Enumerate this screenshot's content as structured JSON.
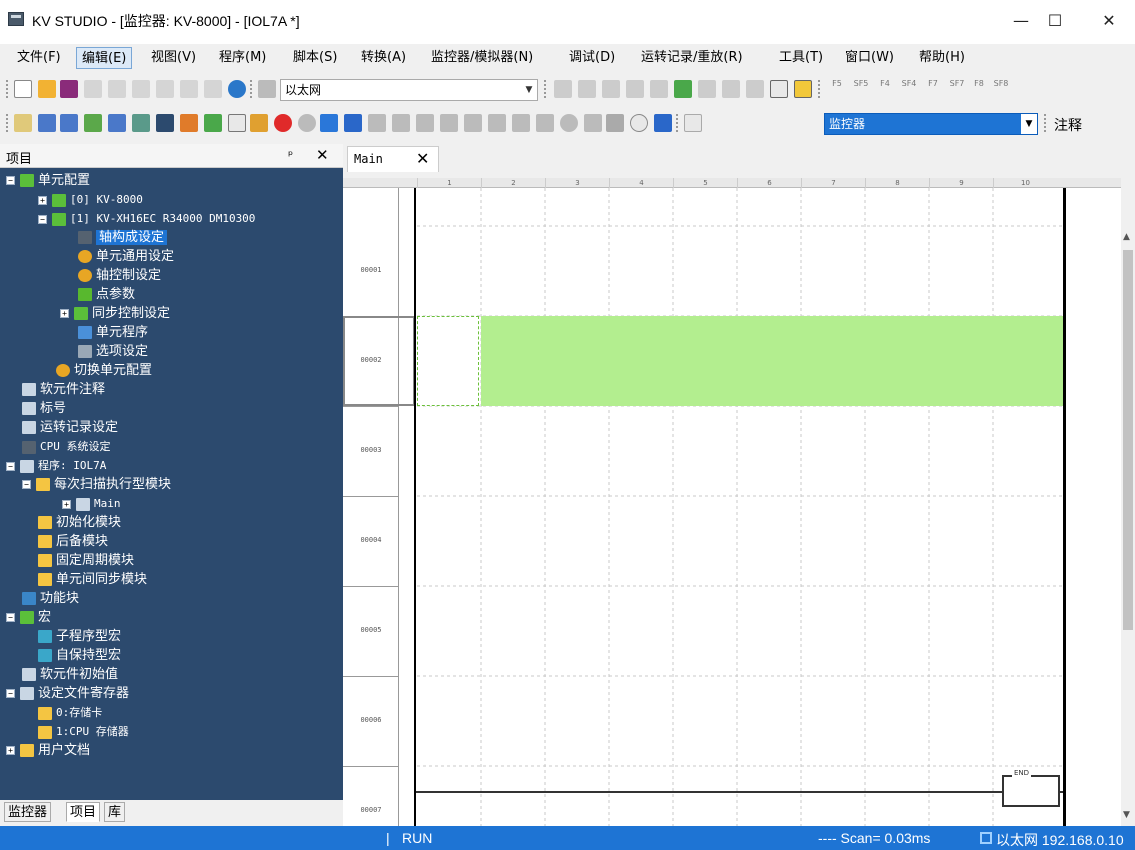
{
  "window": {
    "title": "KV STUDIO - [监控器: KV-8000] - [IOL7A *]",
    "minimize": "—",
    "maximize": "☐",
    "close": "✕"
  },
  "menubar": {
    "items": [
      {
        "label": "文件(F)"
      },
      {
        "label": "编辑(E)"
      },
      {
        "label": "视图(V)"
      },
      {
        "label": "程序(M)"
      },
      {
        "label": "脚本(S)"
      },
      {
        "label": "转换(A)"
      },
      {
        "label": "监控器/模拟器(N)"
      },
      {
        "label": "调试(D)"
      },
      {
        "label": "运转记录/重放(R)"
      },
      {
        "label": "工具(T)"
      },
      {
        "label": "窗口(W)"
      },
      {
        "label": "帮助(H)"
      }
    ]
  },
  "toolbar1": {
    "connection": "以太网",
    "fkeys": [
      "F5",
      "SF5",
      "F4",
      "SF4",
      "F7",
      "SF7",
      "F8",
      "SF8"
    ]
  },
  "toolbar2": {
    "mode": "监控器",
    "comment_label": "注释"
  },
  "left_panel": {
    "title": "项目",
    "pin": "📌",
    "close": "✕",
    "tree": [
      {
        "label": "单元配置"
      },
      {
        "label": "[0]  KV-8000"
      },
      {
        "label": "[1]  KV-XH16EC    R34000  DM10300"
      },
      {
        "label": "轴构成设定"
      },
      {
        "label": "单元通用设定"
      },
      {
        "label": "轴控制设定"
      },
      {
        "label": "点参数"
      },
      {
        "label": "同步控制设定"
      },
      {
        "label": "单元程序"
      },
      {
        "label": "选项设定"
      },
      {
        "label": "切换单元配置"
      },
      {
        "label": "软元件注释"
      },
      {
        "label": "标号"
      },
      {
        "label": "运转记录设定"
      },
      {
        "label": "CPU 系统设定"
      },
      {
        "label": "程序: IOL7A"
      },
      {
        "label": "每次扫描执行型模块"
      },
      {
        "label": "Main"
      },
      {
        "label": "初始化模块"
      },
      {
        "label": "后备模块"
      },
      {
        "label": "固定周期模块"
      },
      {
        "label": "单元间同步模块"
      },
      {
        "label": "功能块"
      },
      {
        "label": "宏"
      },
      {
        "label": "子程序型宏"
      },
      {
        "label": "自保持型宏"
      },
      {
        "label": "软元件初始值"
      },
      {
        "label": "设定文件寄存器"
      },
      {
        "label": "0:存储卡"
      },
      {
        "label": "1:CPU 存储器"
      },
      {
        "label": "用户文档"
      }
    ],
    "tabs": [
      {
        "label": "监控器"
      },
      {
        "label": "项目"
      },
      {
        "label": "库"
      }
    ]
  },
  "editor": {
    "tab_label": "Main",
    "tab_close": "✕",
    "columns": [
      "1",
      "2",
      "3",
      "4",
      "5",
      "6",
      "7",
      "8",
      "9",
      "10"
    ],
    "rungs": [
      {
        "label": "00001"
      },
      {
        "label": "00002"
      },
      {
        "label": "00003"
      },
      {
        "label": "00004"
      },
      {
        "label": "00005"
      },
      {
        "label": "00006"
      },
      {
        "label": "00007"
      }
    ],
    "end_label": "END"
  },
  "statusbar": {
    "separator": "|",
    "run_state": "RUN",
    "scan": "----  Scan=   0.03ms",
    "network": "以太网    192.168.0.10"
  }
}
